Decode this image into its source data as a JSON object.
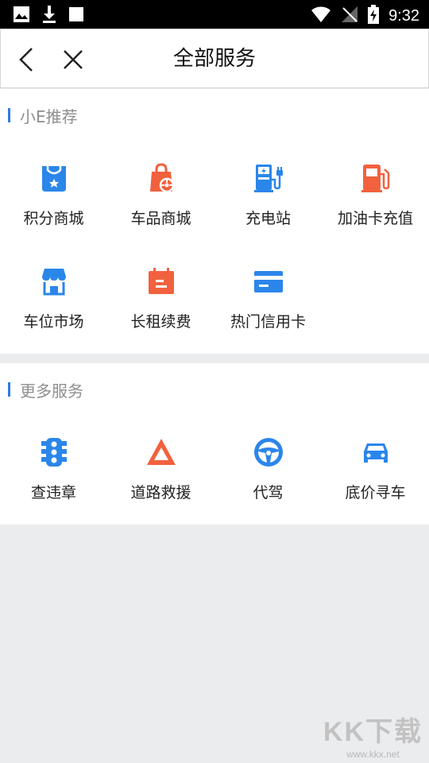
{
  "status_bar": {
    "time": "9:32"
  },
  "nav": {
    "title": "全部服务"
  },
  "sections": [
    {
      "title": "小E推荐",
      "items": [
        {
          "label": "积分商城",
          "icon": "points-mall-icon",
          "color": "#2b86ea"
        },
        {
          "label": "车品商城",
          "icon": "car-goods-mall-icon",
          "color": "#f2613e"
        },
        {
          "label": "充电站",
          "icon": "charging-station-icon",
          "color": "#2b86ea"
        },
        {
          "label": "加油卡充值",
          "icon": "fuel-card-icon",
          "color": "#f2613e"
        },
        {
          "label": "车位市场",
          "icon": "parking-market-icon",
          "color": "#2b86ea"
        },
        {
          "label": "长租续费",
          "icon": "long-rent-renewal-icon",
          "color": "#f2613e"
        },
        {
          "label": "热门信用卡",
          "icon": "credit-card-icon",
          "color": "#2b86ea"
        }
      ]
    },
    {
      "title": "更多服务",
      "items": [
        {
          "label": "查违章",
          "icon": "traffic-light-icon",
          "color": "#2b86ea"
        },
        {
          "label": "道路救援",
          "icon": "warning-triangle-icon",
          "color": "#f2613e"
        },
        {
          "label": "代驾",
          "icon": "steering-wheel-icon",
          "color": "#2b86ea"
        },
        {
          "label": "底价寻车",
          "icon": "car-icon",
          "color": "#2b86ea"
        }
      ]
    }
  ],
  "watermark": {
    "logo": "KK下载",
    "url": "www.kkx.net"
  }
}
